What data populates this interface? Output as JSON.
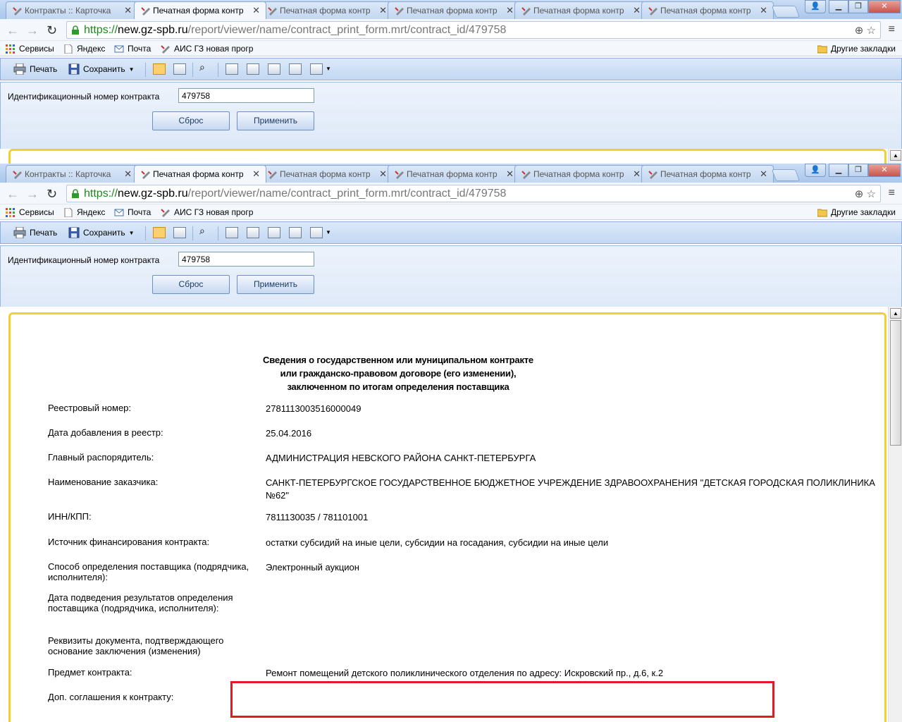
{
  "browser": {
    "tabs": [
      {
        "title": "Контракты :: Карточка"
      },
      {
        "title": "Печатная форма контр"
      },
      {
        "title": "Печатная форма контр"
      },
      {
        "title": "Печатная форма контр"
      },
      {
        "title": "Печатная форма контр"
      },
      {
        "title": "Печатная форма контр"
      }
    ],
    "url": {
      "proto": "https://",
      "host": "new.gz-spb.ru",
      "path": "/report/viewer/name/contract_print_form.mrt/contract_id/479758"
    },
    "bookmarks": [
      {
        "label": "Сервисы"
      },
      {
        "label": "Яндекс"
      },
      {
        "label": "Почта"
      },
      {
        "label": "АИС ГЗ новая прогр"
      }
    ],
    "other_bookmarks": "Другие закладки"
  },
  "toolbar": {
    "print_label": "Печать",
    "save_label": "Сохранить"
  },
  "params": {
    "contract_id_label": "Идентификационный номер контракта",
    "contract_id_value": "479758",
    "reset_label": "Сброс",
    "apply_label": "Применить"
  },
  "report": {
    "title_line1": "Сведения о государственном или муниципальном контракте",
    "title_line2": "или гражданско-правовом договоре (его изменении),",
    "title_line3": "заключенном по итогам определения поставщика",
    "rows": [
      {
        "label": "Реестровый номер:",
        "value": "2781113003516000049"
      },
      {
        "label": "Дата добавления в реестр:",
        "value": "25.04.2016"
      },
      {
        "label": "Главный распорядитель:",
        "value": "АДМИНИСТРАЦИЯ НЕВСКОГО РАЙОНА САНКТ-ПЕТЕРБУРГА"
      },
      {
        "label": "Наименование заказчика:",
        "value": "САНКТ-ПЕТЕРБУРГСКОЕ ГОСУДАРСТВЕННОЕ БЮДЖЕТНОЕ УЧРЕЖДЕНИЕ ЗДРАВООХРАНЕНИЯ \"ДЕТСКАЯ ГОРОДСКАЯ ПОЛИКЛИНИКА №62\""
      },
      {
        "label": "ИНН/КПП:",
        "value": "7811130035 / 781101001"
      },
      {
        "label": "Источник финансирования контракта:",
        "value": "остатки субсидий на иные цели, субсидии на госадания, субсидии на иные цели"
      },
      {
        "label": "Способ определения поставщика (подрядчика, исполнителя):",
        "value": "Электронный аукцион"
      },
      {
        "label": "Дата подведения результатов определения поставщика (подрядчика, исполнителя):",
        "value": ""
      },
      {
        "label": "Реквизиты документа, подтверждающего основание заключения (изменения)",
        "value": ""
      },
      {
        "label": "Предмет контракта:",
        "value": "Ремонт помещений детского поликлинического отделения по адресу: Искровский пр., д.6, к.2"
      },
      {
        "label": "Доп. соглашения к контракту:",
        "value": ""
      }
    ]
  }
}
